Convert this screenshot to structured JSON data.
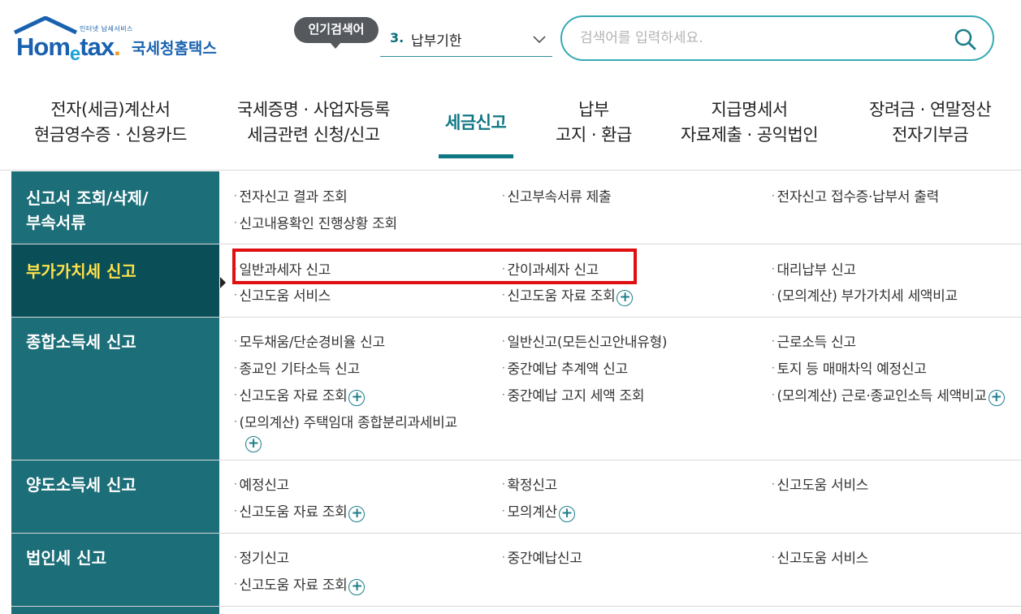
{
  "header": {
    "logo": {
      "tagline": "인터넷 납세서비스",
      "brand_en": "Hometax",
      "brand_kr": "국세청홈택스"
    },
    "popular_badge": "인기검색어",
    "popular_rank": "3.",
    "popular_keyword": "납부기한",
    "search_placeholder": "검색어를 입력하세요."
  },
  "gnb": [
    {
      "line1": "전자(세금)계산서",
      "line2": "현금영수증 · 신용카드"
    },
    {
      "line1": "국세증명 · 사업자등록",
      "line2": "세금관련 신청/신고"
    },
    {
      "line1": "세금신고",
      "line2": ""
    },
    {
      "line1": "납부",
      "line2": "고지 · 환급"
    },
    {
      "line1": "지급명세서",
      "line2": "자료제출 · 공익법인"
    },
    {
      "line1": "장려금 · 연말정산",
      "line2": "전자기부금"
    }
  ],
  "sections": [
    {
      "title1": "신고서 조회/삭제/",
      "title2": "부속서류",
      "links": [
        "전자신고 결과 조회",
        "신고부속서류 제출",
        "전자신고 접수증·납부서 출력",
        "신고내용확인 진행상황 조회"
      ]
    },
    {
      "title1": "부가가치세 신고",
      "title2": "",
      "links": [
        "일반과세자 신고",
        "간이과세자 신고",
        "대리납부 신고",
        "신고도움 서비스",
        "신고도움 자료 조회",
        "(모의계산) 부가가치세 세액비교"
      ]
    },
    {
      "title1": "종합소득세 신고",
      "title2": "",
      "links": [
        "모두채움/단순경비율 신고",
        "일반신고(모든신고안내유형)",
        "근로소득 신고",
        "종교인 기타소득 신고",
        "중간예납 추계액 신고",
        "토지 등 매매차익 예정신고",
        "신고도움 자료 조회",
        "중간예납 고지 세액 조회",
        "(모의계산) 근로·종교인소득 세액비교",
        "(모의계산) 주택임대 종합분리과세비교"
      ]
    },
    {
      "title1": "양도소득세 신고",
      "title2": "",
      "links": [
        "예정신고",
        "확정신고",
        "신고도움 서비스",
        "신고도움 자료 조회",
        "모의계산"
      ]
    },
    {
      "title1": "법인세 신고",
      "title2": "",
      "links": [
        "정기신고",
        "중간예납신고",
        "신고도움 서비스",
        "신고도움 자료 조회"
      ]
    }
  ],
  "colors": {
    "teal": "#1c6e78",
    "teal_dark": "#0a4f57",
    "active_text": "#ffe24a",
    "highlight": "#e01010"
  },
  "icons": {
    "plus": "+"
  }
}
